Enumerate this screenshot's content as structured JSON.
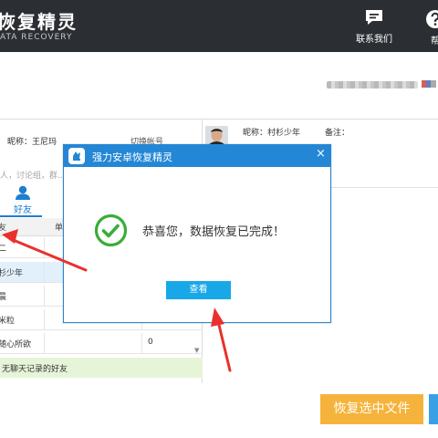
{
  "header": {
    "brand_cn": "恢复精灵",
    "brand_en": "ATA RECOVERY",
    "contact_label": "联系我们",
    "help_label": "帮"
  },
  "colors": {
    "header_bg": "#2b2e33",
    "accent_blue": "#2487d6",
    "button_orange": "#f6b33b",
    "annotation_red": "#e8312d",
    "check_green": "#3aad3a"
  },
  "left_panel": {
    "nickname": "昵称：王尼玛",
    "switch_account": "切换帐号",
    "search_placeholder": "人，讨论组，群...",
    "tab_friends": "好友",
    "table": {
      "col_name": "友",
      "col_count": "单",
      "rows": [
        {
          "name": "二",
          "count": ""
        },
        {
          "name": "杉少年",
          "count": ""
        },
        {
          "name": "晨",
          "count": ""
        },
        {
          "name": "米粒",
          "count": "0"
        },
        {
          "name": "随心所欲",
          "count": "0"
        }
      ]
    },
    "no_record_note": "无聊天记录的好友"
  },
  "right_panel": {
    "peer_nickname": "昵称：村杉少年",
    "remark_label": "备注："
  },
  "recover_button_label": "恢复选中文件",
  "dialog": {
    "title": "强力安卓恢复精灵",
    "close_glyph": "×",
    "message": "恭喜您，数据恢复已完成！",
    "view_button": "查看"
  },
  "icons": [
    "chat-icon",
    "help-icon",
    "person-icon",
    "app-logo-icon",
    "check-circle-icon",
    "close-icon",
    "scroll-down-icon"
  ]
}
